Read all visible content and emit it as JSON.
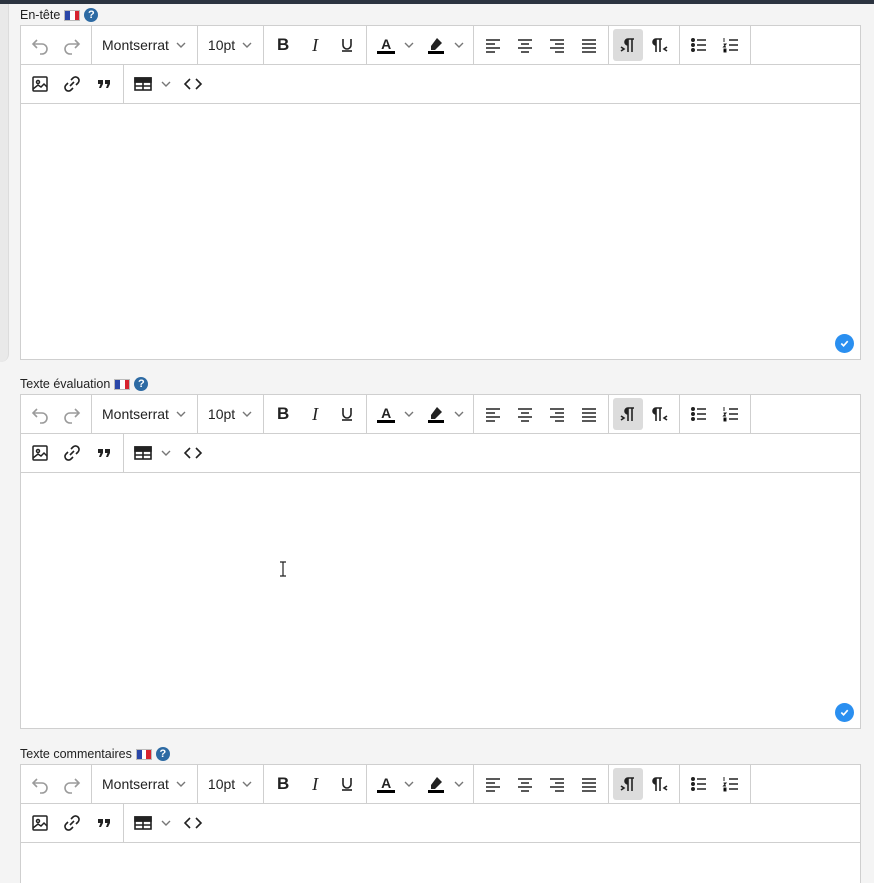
{
  "colors": {
    "accent": "#2a8ff0",
    "help_badge": "#2d6aa3",
    "active_button": "#dcdcdc",
    "border": "#cfcfcf",
    "page_bg": "#f4f4f4"
  },
  "fields": [
    {
      "label": "En-tête",
      "language_flag": "fr-flag-icon",
      "help_text": "?"
    },
    {
      "label": "Texte évaluation",
      "language_flag": "fr-flag-icon",
      "help_text": "?"
    },
    {
      "label": "Texte commentaires",
      "language_flag": "fr-flag-icon",
      "help_text": "?"
    }
  ],
  "toolbar": {
    "font_family": "Montserrat",
    "font_size": "10pt",
    "bold_label": "B",
    "italic_label": "I",
    "underline_label": "U",
    "text_color_label": "A",
    "icons_row1": [
      "undo-icon",
      "redo-icon",
      "bold-icon",
      "italic-icon",
      "underline-icon",
      "text-color-icon",
      "highlight-icon",
      "align-left-icon",
      "align-center-icon",
      "align-right-icon",
      "align-justify-icon",
      "ltr-icon",
      "rtl-icon",
      "bullet-list-icon",
      "numbered-list-icon"
    ],
    "icons_row2": [
      "image-icon",
      "link-icon",
      "blockquote-icon",
      "table-icon",
      "source-code-icon"
    ],
    "active_tool": "ltr-icon"
  }
}
